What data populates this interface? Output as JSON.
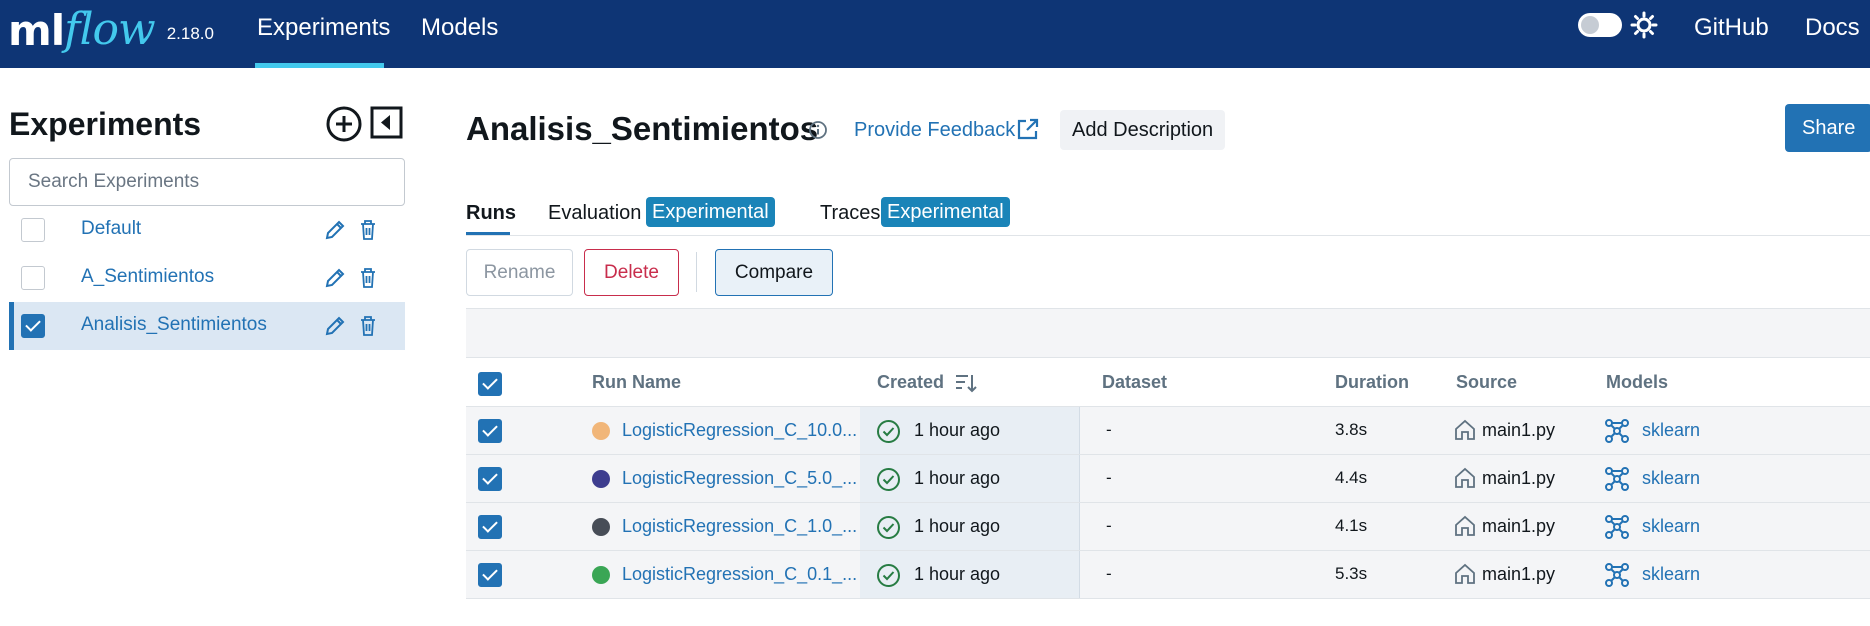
{
  "app": {
    "logo_ml": "ml",
    "logo_flow": "flow",
    "version": "2.18.0"
  },
  "nav": {
    "experiments": "Experiments",
    "models": "Models",
    "github": "GitHub",
    "docs": "Docs"
  },
  "sidebar": {
    "title": "Experiments",
    "search_placeholder": "Search Experiments",
    "experiments": [
      {
        "name": "Default",
        "checked": false
      },
      {
        "name": "A_Sentimientos",
        "checked": false
      },
      {
        "name": "Analisis_Sentimientos",
        "checked": true
      }
    ]
  },
  "header": {
    "title": "Analisis_Sentimientos",
    "feedback": "Provide Feedback",
    "add_description": "Add Description",
    "share": "Share"
  },
  "tabs": {
    "runs": "Runs",
    "evaluation": "Evaluation",
    "traces": "Traces",
    "badge": "Experimental"
  },
  "actions": {
    "rename": "Rename",
    "delete": "Delete",
    "compare": "Compare"
  },
  "table": {
    "columns": [
      "Run Name",
      "Created",
      "Dataset",
      "Duration",
      "Source",
      "Models"
    ],
    "rows": [
      {
        "name": "LogisticRegression_C_10.0...",
        "color": "#f1b679",
        "created": "1 hour ago",
        "dataset": "-",
        "duration": "3.8s",
        "source": "main1.py",
        "model": "sklearn"
      },
      {
        "name": "LogisticRegression_C_5.0_...",
        "color": "#3d3d8f",
        "created": "1 hour ago",
        "dataset": "-",
        "duration": "4.4s",
        "source": "main1.py",
        "model": "sklearn"
      },
      {
        "name": "LogisticRegression_C_1.0_...",
        "color": "#474d57",
        "created": "1 hour ago",
        "dataset": "-",
        "duration": "4.1s",
        "source": "main1.py",
        "model": "sklearn"
      },
      {
        "name": "LogisticRegression_C_0.1_...",
        "color": "#3aa655",
        "created": "1 hour ago",
        "dataset": "-",
        "duration": "5.3s",
        "source": "main1.py",
        "model": "sklearn"
      }
    ]
  }
}
